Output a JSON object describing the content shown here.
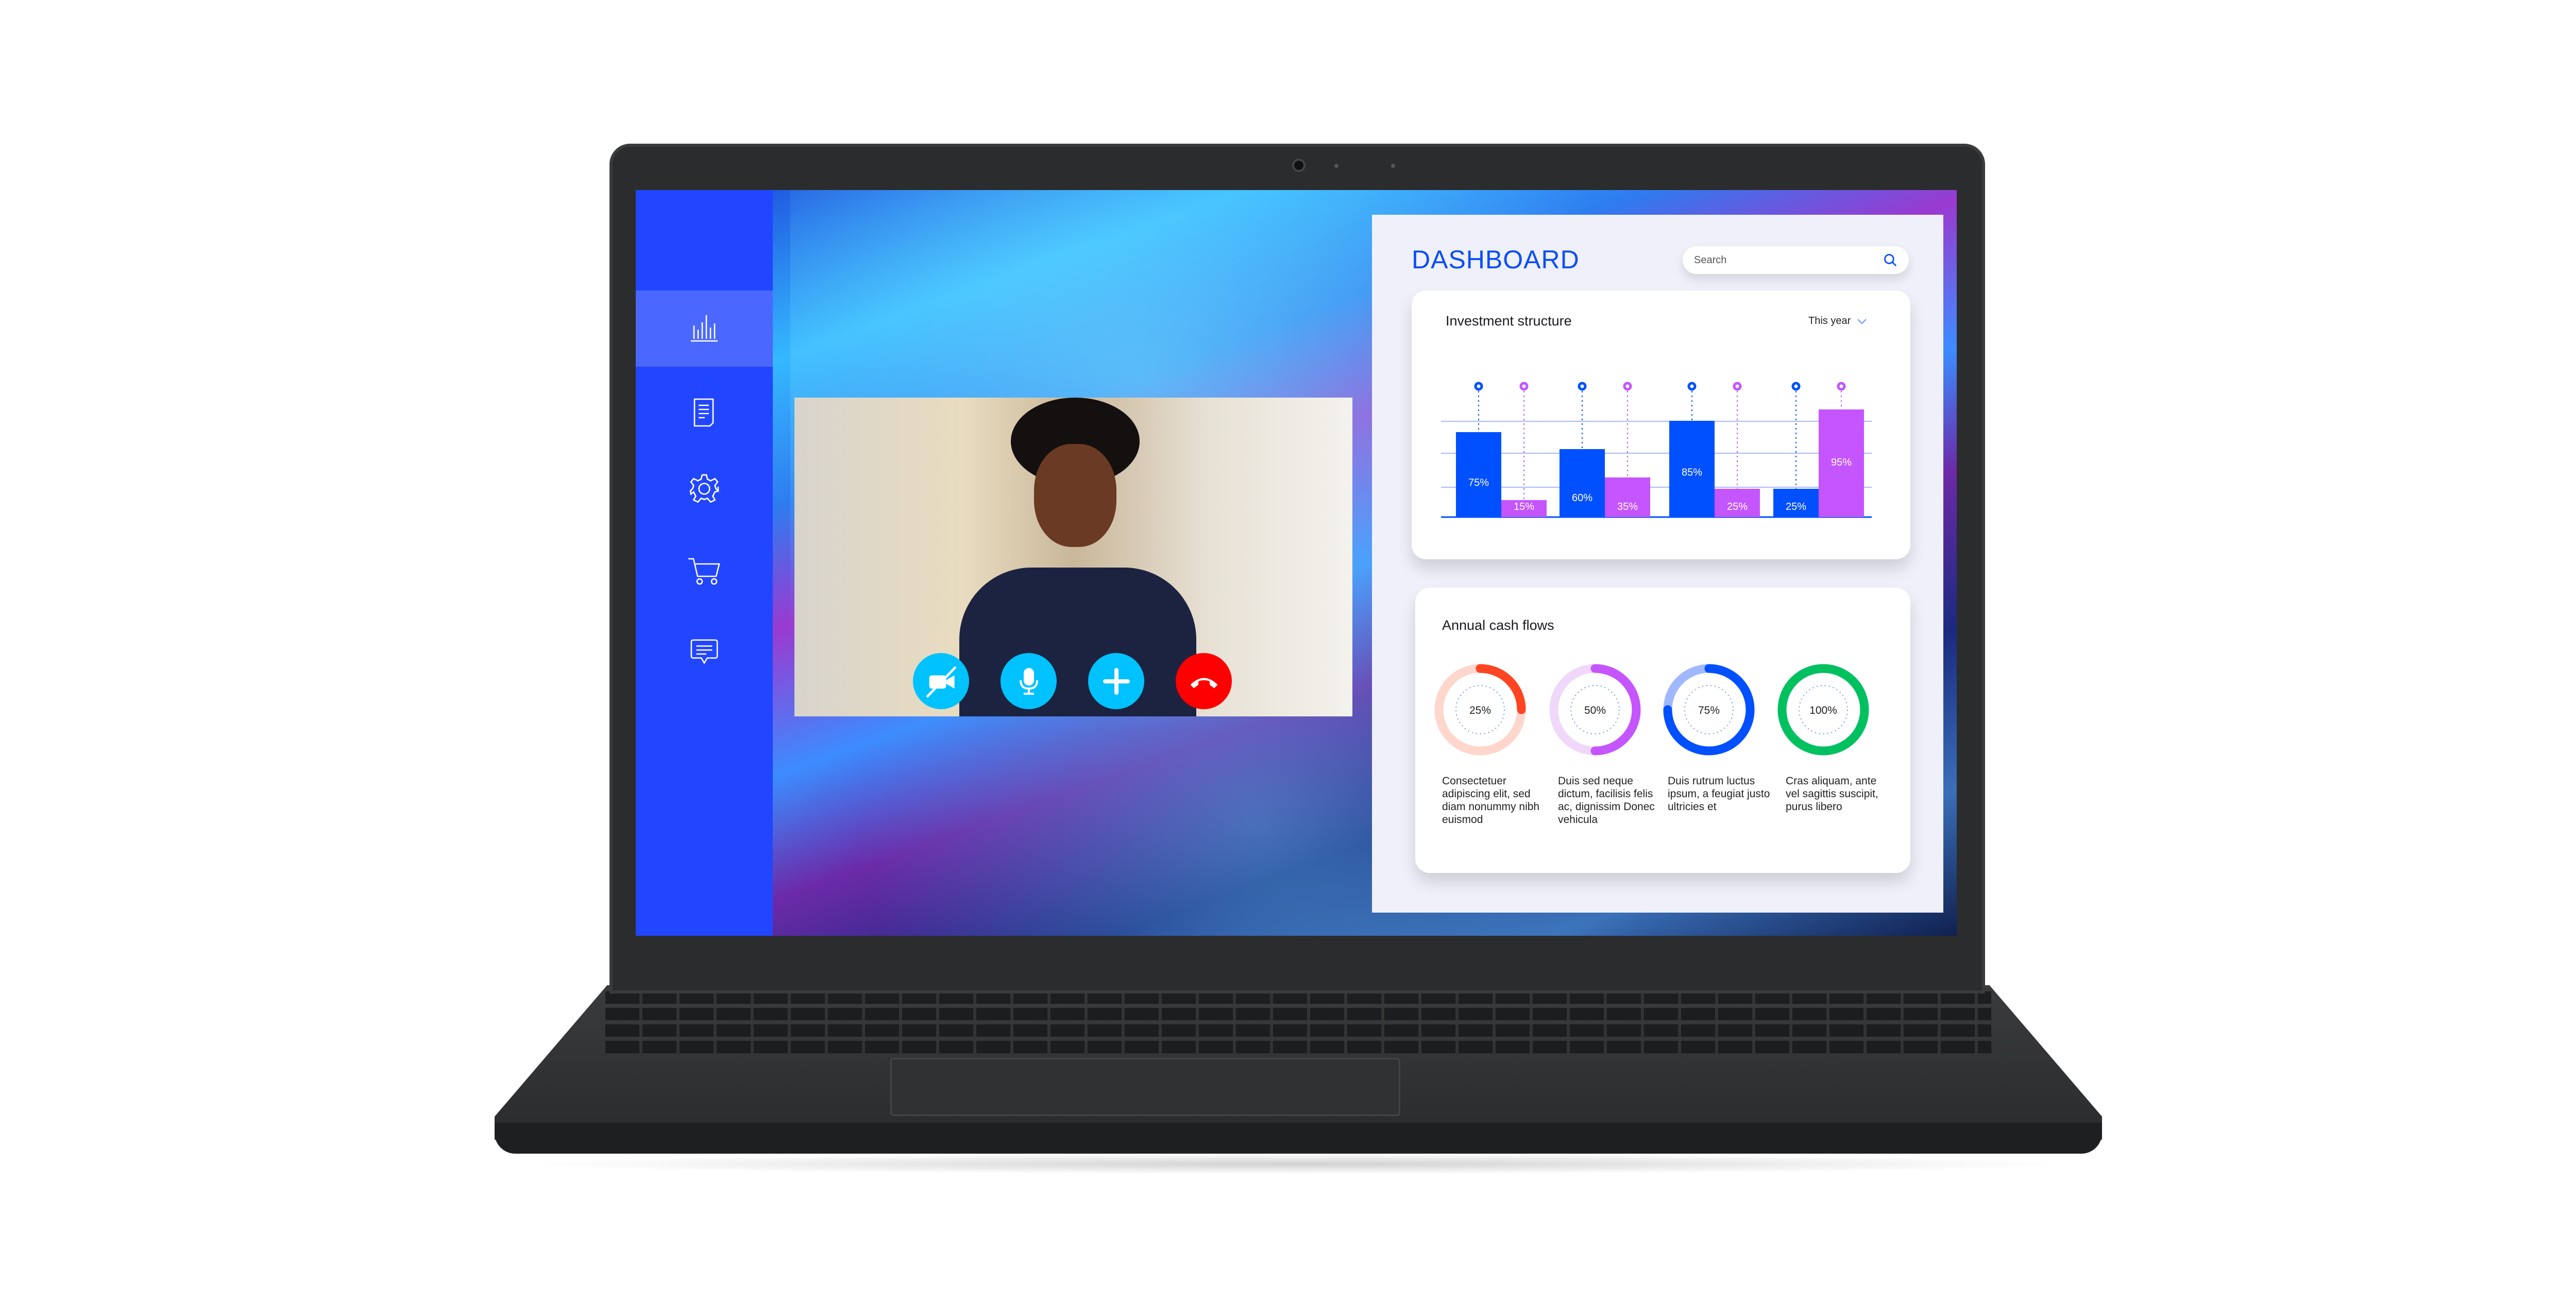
{
  "dashboard": {
    "title": "DASHBOARD",
    "search_placeholder": "Search"
  },
  "sidebar": {
    "items": [
      {
        "icon": "bar-chart-icon",
        "active": true
      },
      {
        "icon": "document-icon"
      },
      {
        "icon": "gear-icon"
      },
      {
        "icon": "cart-icon"
      },
      {
        "icon": "chat-icon"
      }
    ]
  },
  "call_controls": [
    {
      "icon": "camera-off-icon",
      "color": "#00c2ff"
    },
    {
      "icon": "microphone-icon",
      "color": "#00c2ff"
    },
    {
      "icon": "plus-icon",
      "color": "#00c2ff"
    },
    {
      "icon": "hang-up-icon",
      "color": "#ff0000"
    }
  ],
  "investment": {
    "title": "Investment structure",
    "period": "This year"
  },
  "cash_flows": {
    "title": "Annual cash flows"
  },
  "colors": {
    "accent": "#0b4ef5",
    "sidebar": "#2246ff",
    "blue": "#0050ff",
    "purple": "#c455ff"
  },
  "chart_data": [
    {
      "type": "bar",
      "title": "Investment structure",
      "ylim": [
        0,
        100
      ],
      "series": [
        {
          "color": "#0050ff",
          "values": [
            75,
            60,
            85,
            25
          ],
          "labels": [
            "75%",
            "60%",
            "85%",
            "25%"
          ]
        },
        {
          "color": "#c455ff",
          "values": [
            15,
            35,
            25,
            95
          ],
          "labels": [
            "15%",
            "35%",
            "25%",
            "95%"
          ]
        }
      ]
    },
    {
      "type": "pie",
      "title": "Annual cash flows",
      "rings": [
        {
          "value": 25,
          "label": "25%",
          "color": "#ff4422",
          "track": "#ffd6cc",
          "text": "Consectetuer adipiscing elit, sed diam nonummy nibh euismod"
        },
        {
          "value": 50,
          "label": "50%",
          "color": "#c455ff",
          "track": "#f0d8fa",
          "text": "Duis sed neque dictum, facilisis felis ac, dignissim Donec vehicula"
        },
        {
          "value": 75,
          "label": "75%",
          "color": "#0050ff",
          "track": "#a0b8ff",
          "text": "Duis rutrum luctus ipsum, a feugiat justo ultricies et"
        },
        {
          "value": 100,
          "label": "100%",
          "color": "#00c060",
          "track": "#b0f0cc",
          "text": "Cras aliquam, ante vel sagittis suscipit, purus libero"
        }
      ]
    }
  ]
}
